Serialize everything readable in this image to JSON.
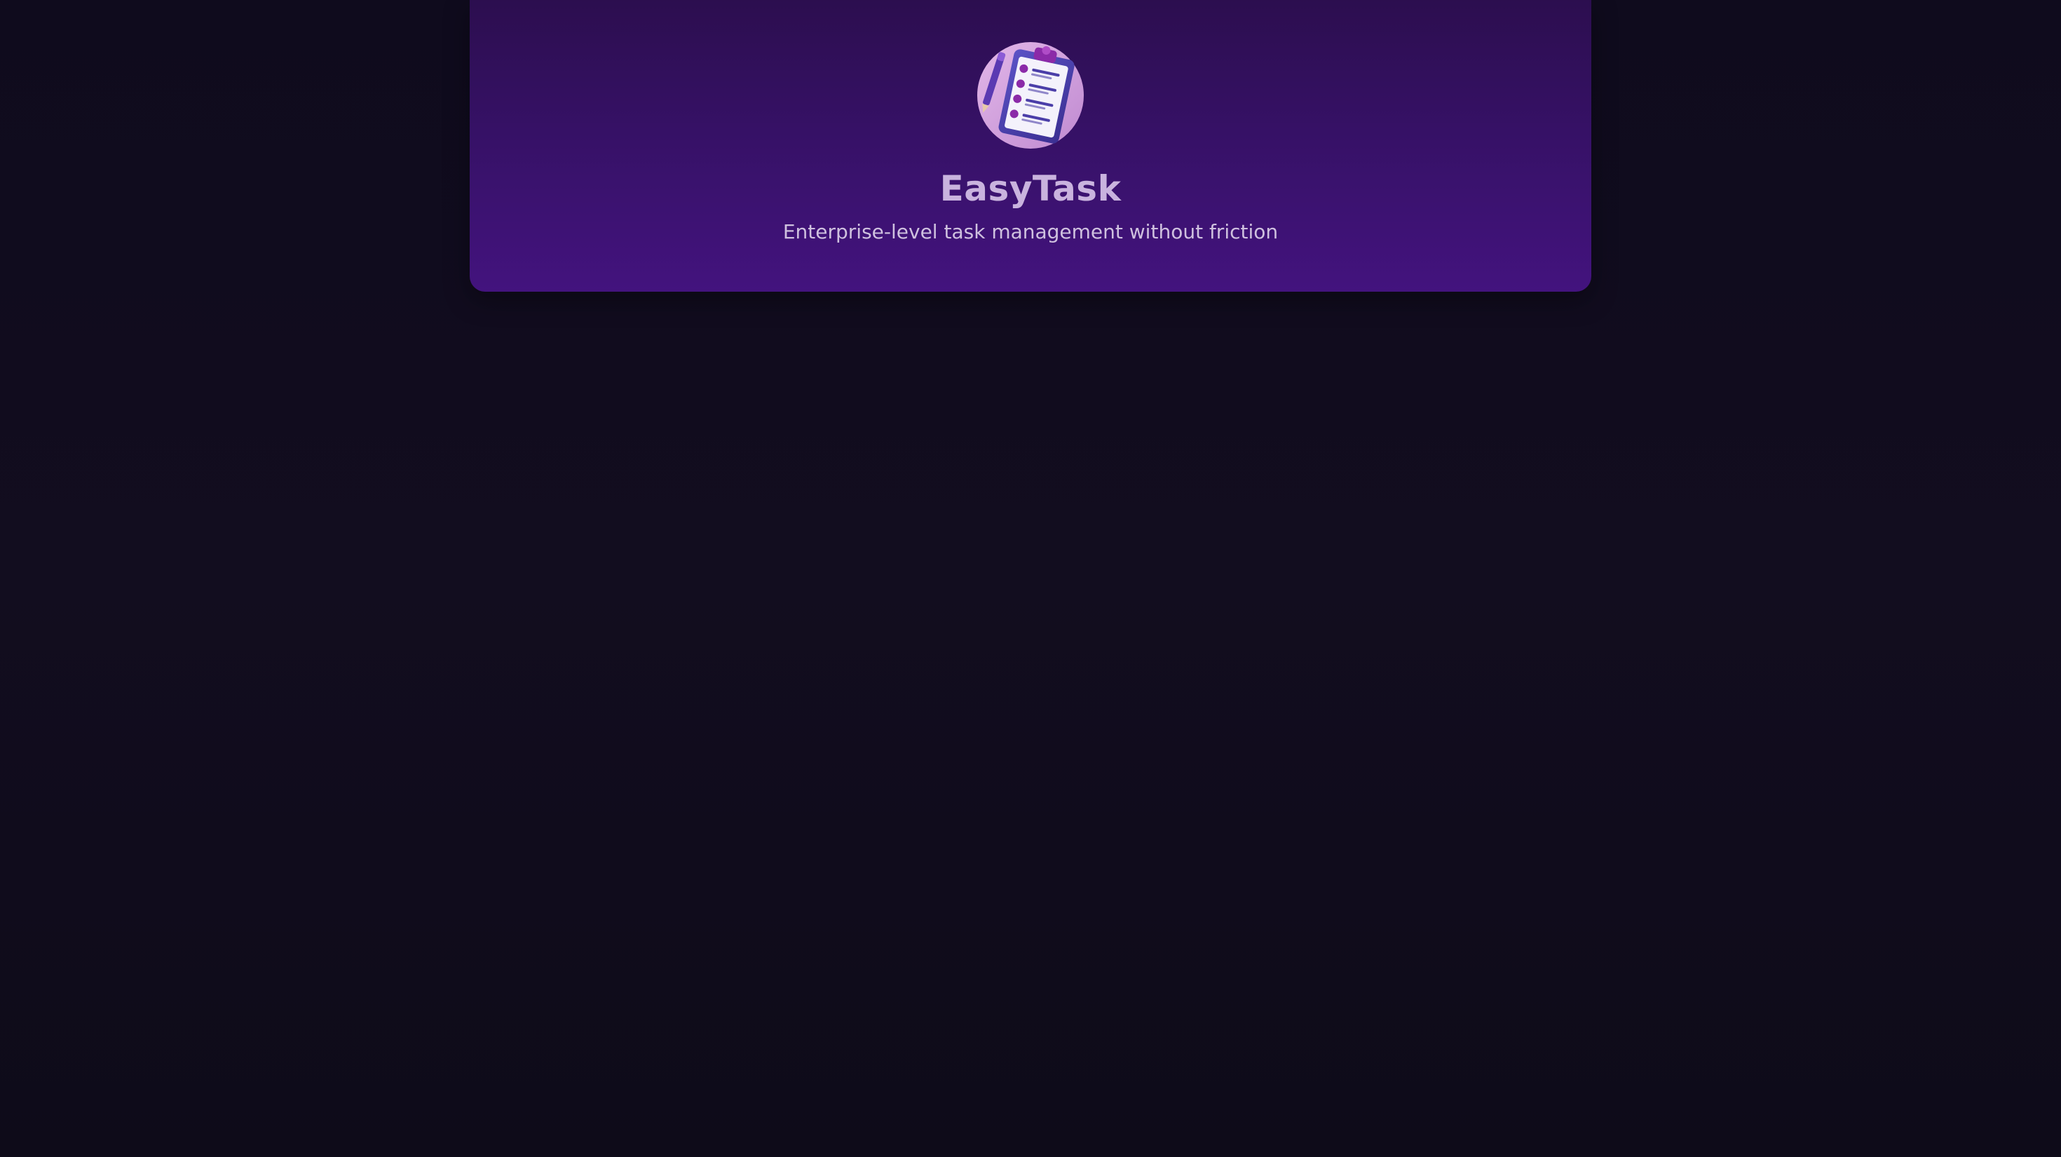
{
  "header": {
    "logo_icon": "clipboard-checklist-icon",
    "title": "EasyTask",
    "subtitle": "Enterprise-level task management without friction"
  },
  "colors": {
    "background": "#110d1e",
    "header_top": "#2c0e4f",
    "header_bottom": "#43137e",
    "title": "#c9b3de",
    "subtitle": "#cfc1df",
    "logo_circle": "#cc9ad8",
    "clipboard": "#4b3ea8",
    "bullet": "#8b2aa8"
  }
}
